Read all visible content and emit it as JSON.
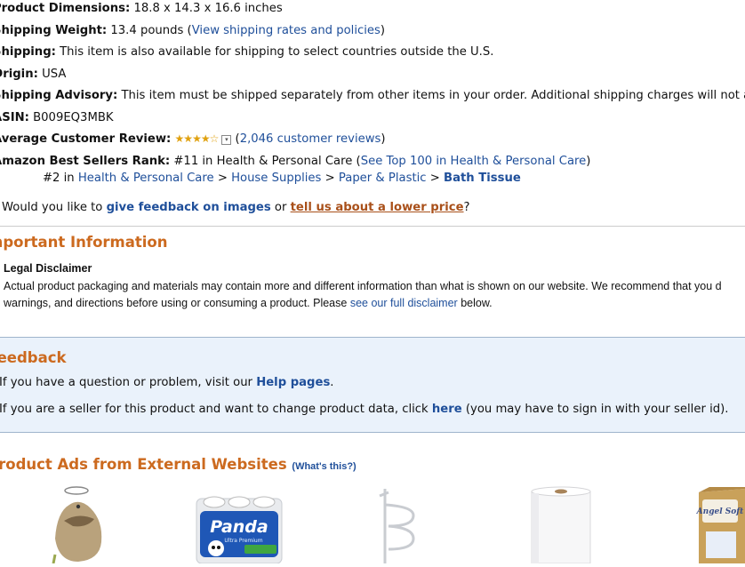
{
  "details": {
    "dimensions": {
      "label": "Product Dimensions:",
      "value": "18.8 x 14.3 x 16.6 inches"
    },
    "weight": {
      "label": "Shipping Weight:",
      "value": "13.4 pounds (",
      "link": "View shipping rates and policies",
      "tail": ")"
    },
    "shipping": {
      "label": "Shipping:",
      "value": "This item is also available for shipping to select countries outside the U.S."
    },
    "origin": {
      "label": "Origin:",
      "value": "USA"
    },
    "advisory": {
      "label": "Shipping Advisory:",
      "value": "This item must be shipped separately from other items in your order. Additional shipping charges will not a"
    },
    "asin": {
      "label": "ASIN:",
      "value": "B009EQ3MBK"
    },
    "review": {
      "label": "Average Customer Review:",
      "stars": "★★★★☆",
      "dropdown": "▾",
      "open": " (",
      "link": "2,046 customer reviews",
      "close": ")"
    },
    "rank": {
      "label": "Amazon Best Sellers Rank:",
      "value": "#11 in Health & Personal Care (",
      "link": "See Top 100 in Health & Personal Care",
      "tail": ")",
      "sub_prefix": "#2 in",
      "crumbs": [
        "Health & Personal Care",
        "House Supplies",
        "Paper & Plastic"
      ],
      "sep": ">",
      "last": "Bath Tissue"
    },
    "feedback_q": {
      "prefix": "Would you like to",
      "link1": "give feedback on images",
      "mid": "or",
      "link2": "tell us about a lower price",
      "suffix": "?"
    }
  },
  "important": {
    "title": "Important Information",
    "legal_heading": "Legal Disclaimer",
    "legal_text_1": "Actual product packaging and materials may contain more and different information than what is shown on our website. We recommend that you d",
    "legal_text_2": "warnings, and directions before using or consuming a product. Please",
    "legal_link": "see our full disclaimer",
    "legal_tail": "below."
  },
  "feedback": {
    "title": "Feedback",
    "line1_prefix": "If you have a question or problem, visit our",
    "line1_link": "Help pages",
    "line1_tail": ".",
    "line2_prefix": "If you are a seller for this product and want to change product data, click",
    "line2_link": "here",
    "line2_tail": "(you may have to sign in with your seller id)."
  },
  "ads": {
    "title": "Product Ads from External Websites",
    "whats_this": "(What's this?)",
    "products": [
      {
        "name": "hedgehog-toy"
      },
      {
        "name": "panda-toilet-paper",
        "brand": "Panda",
        "tag": "Ultra Premium"
      },
      {
        "name": "towel-rack"
      },
      {
        "name": "paper-towel-roll"
      },
      {
        "name": "angel-soft-box",
        "brand": "Angel Soft"
      }
    ]
  },
  "colors": {
    "link": "#1f4f9a",
    "section_title": "#cc6a1f",
    "feedback_bg": "#eaf2fb",
    "star": "#e0a10f"
  }
}
